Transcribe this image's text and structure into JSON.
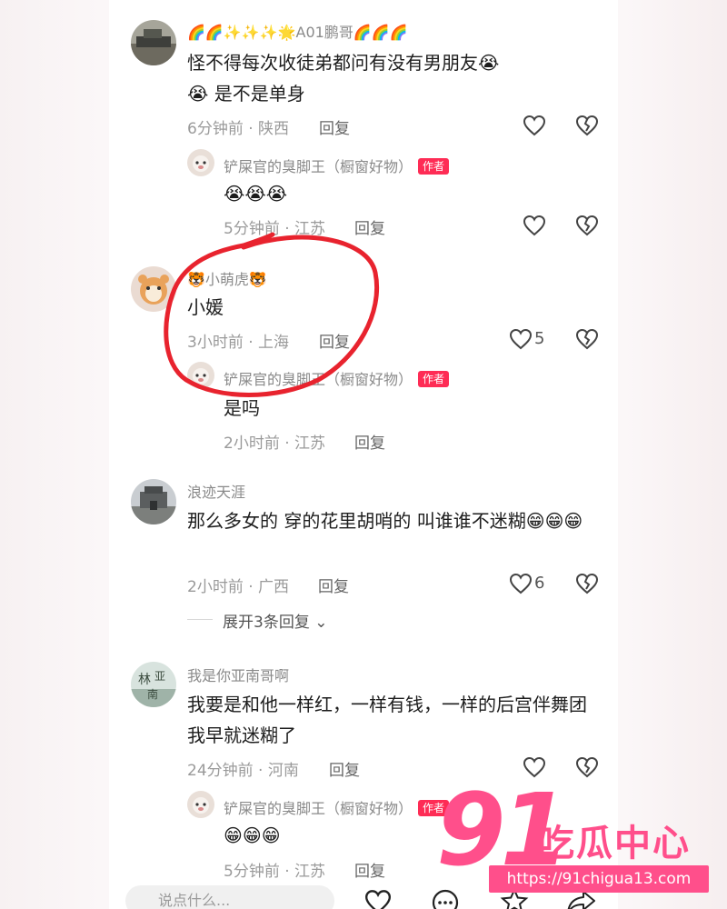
{
  "comments": [
    {
      "username": "🌈🌈✨✨✨🌟A01鹏哥🌈🌈🌈",
      "text": "怪不得每次收徒弟都问有没有男朋友😭😭 是不是单身",
      "meta": "6分钟前 · 陕西",
      "reply_label": "回复",
      "like_count": "",
      "reply": {
        "username": "铲屎官的臭脚王（橱窗好物）",
        "badge": "作者",
        "text": "😭😭😭",
        "meta": "5分钟前 · 江苏",
        "reply_label": "回复"
      }
    },
    {
      "username": "🐯小萌虎🐯",
      "text": "小媛",
      "meta": "3小时前 · 上海",
      "reply_label": "回复",
      "like_count": "5",
      "reply": {
        "username": "铲屎官的臭脚王（橱窗好物）",
        "badge": "作者",
        "text": "是吗",
        "meta": "2小时前 · 江苏",
        "reply_label": "回复"
      }
    },
    {
      "username": "浪迹天涯",
      "text": "那么多女的  穿的花里胡哨的   叫谁谁不迷糊😁😁😁",
      "meta": "2小时前 · 广西",
      "reply_label": "回复",
      "like_count": "6",
      "expand_label": "展开3条回复"
    },
    {
      "username": "我是你亚南哥啊",
      "text": "我要是和他一样红，一样有钱，一样的后宫伴舞团我早就迷糊了",
      "meta": "24分钟前 · 河南",
      "reply_label": "回复",
      "like_count": "",
      "reply": {
        "username": "铲屎官的臭脚王（橱窗好物）",
        "badge": "作者",
        "text": "😁😁😁",
        "meta": "5分钟前 · 江苏",
        "reply_label": "回复"
      }
    }
  ],
  "bottom": {
    "input_placeholder": "说点什么..."
  },
  "watermark": {
    "number": "91",
    "name": "吃瓜中心",
    "url": "https://91chigua13.com"
  },
  "colors": {
    "badge": "#fe2c55",
    "annotation": "#e8232e",
    "watermark": "#ff4f8b"
  }
}
